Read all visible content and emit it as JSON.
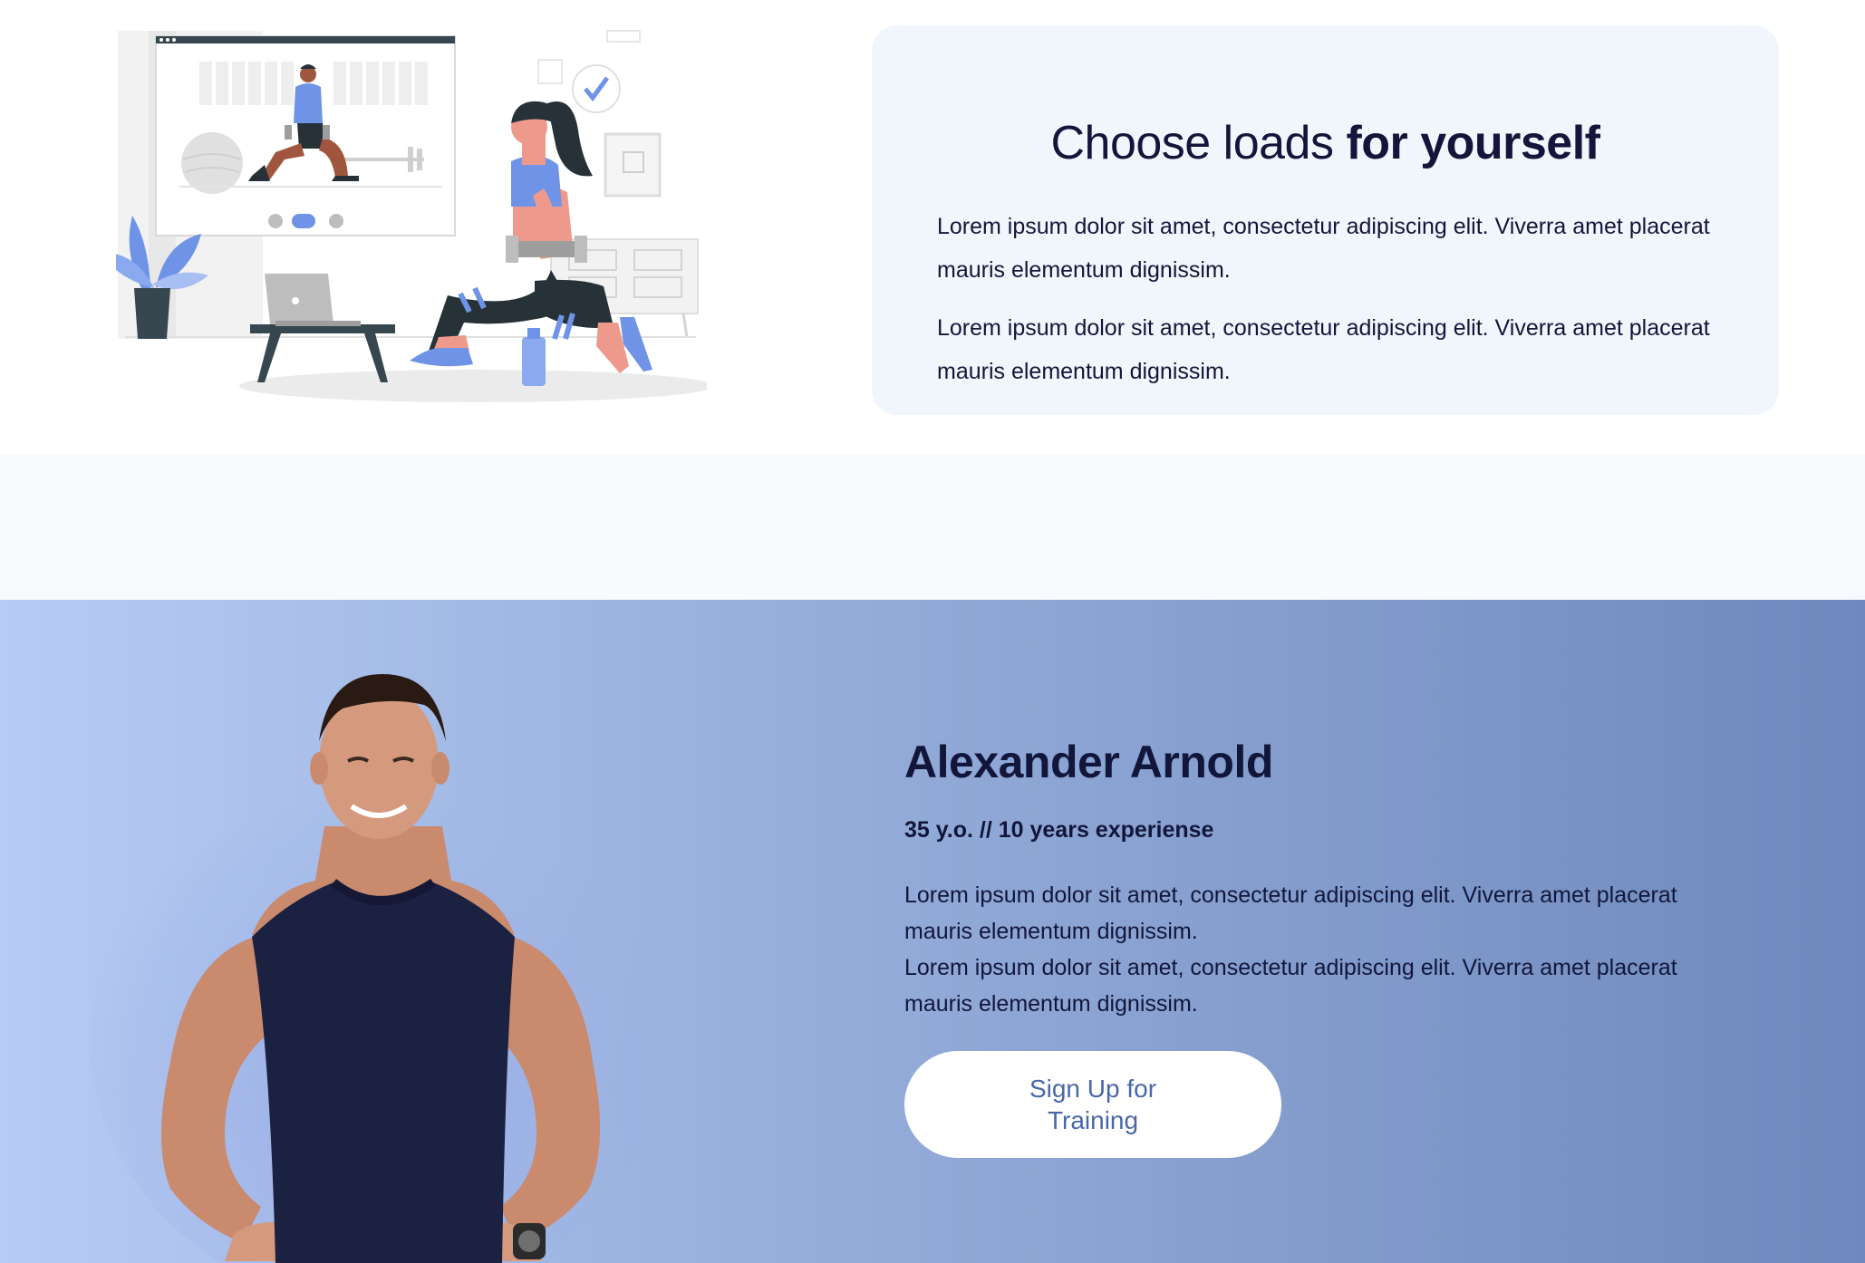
{
  "feature_card": {
    "title_regular": "Choose loads ",
    "title_bold": "for yourself",
    "paragraphs": [
      "Lorem ipsum dolor sit amet, consectetur adipiscing elit. Viverra amet placerat mauris elementum dignissim.",
      "Lorem ipsum dolor sit amet, consectetur adipiscing elit. Viverra amet placerat mauris elementum dignissim."
    ]
  },
  "illustration": {
    "icon": "home-workout-illustration"
  },
  "trainer": {
    "name": "Alexander Arnold",
    "meta": "35 y.o. // 10 years experiense",
    "bio_lines": [
      "Lorem ipsum dolor sit amet, consectetur adipiscing elit. Viverra amet placerat mauris elementum dignissim.",
      "Lorem ipsum dolor sit amet, consectetur adipiscing elit. Viverra amet placerat mauris elementum dignissim."
    ],
    "cta_label": "Sign Up for Training",
    "photo_icon": "trainer-photo"
  },
  "colors": {
    "text_dark": "#12163a",
    "card_bg": "#f1f6fd",
    "accent_blue": "#6f93e6",
    "button_text": "#4967a8",
    "gradient_start": "#b6ccf4",
    "gradient_end": "#6d89bd"
  }
}
